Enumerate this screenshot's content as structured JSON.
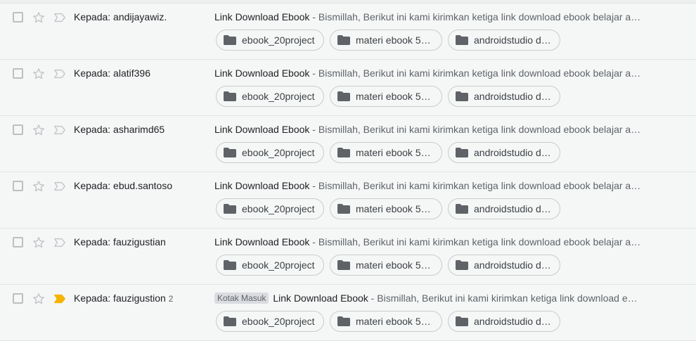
{
  "emails": [
    {
      "sender": "Kepada: andijayawiz.",
      "count": "",
      "label": "",
      "important": false,
      "subject": "Link Download Ebook",
      "separator": " - ",
      "preview": "Bismillah, Berikut ini kami kirimkan ketiga link download ebook belajar a…",
      "attachments": [
        "ebook_20project",
        "materi ebook 5 …",
        "androidstudio d…"
      ]
    },
    {
      "sender": "Kepada: alatif396",
      "count": "",
      "label": "",
      "important": false,
      "subject": "Link Download Ebook",
      "separator": " - ",
      "preview": "Bismillah, Berikut ini kami kirimkan ketiga link download ebook belajar a…",
      "attachments": [
        "ebook_20project",
        "materi ebook 5 …",
        "androidstudio d…"
      ]
    },
    {
      "sender": "Kepada: asharimd65",
      "count": "",
      "label": "",
      "important": false,
      "subject": "Link Download Ebook",
      "separator": " - ",
      "preview": "Bismillah, Berikut ini kami kirimkan ketiga link download ebook belajar a…",
      "attachments": [
        "ebook_20project",
        "materi ebook 5 …",
        "androidstudio d…"
      ]
    },
    {
      "sender": "Kepada: ebud.santoso",
      "count": "",
      "label": "",
      "important": false,
      "subject": "Link Download Ebook",
      "separator": " - ",
      "preview": "Bismillah, Berikut ini kami kirimkan ketiga link download ebook belajar a…",
      "attachments": [
        "ebook_20project",
        "materi ebook 5 …",
        "androidstudio d…"
      ]
    },
    {
      "sender": "Kepada: fauzigustian",
      "count": "",
      "label": "",
      "important": false,
      "subject": "Link Download Ebook",
      "separator": " - ",
      "preview": "Bismillah, Berikut ini kami kirimkan ketiga link download ebook belajar a…",
      "attachments": [
        "ebook_20project",
        "materi ebook 5 …",
        "androidstudio d…"
      ]
    },
    {
      "sender": "Kepada: fauzigustion",
      "count": "2",
      "label": "Kotak Masuk",
      "important": true,
      "subject": "Link Download Ebook",
      "separator": " - ",
      "preview": "Bismillah, Berikut ini kami kirimkan ketiga link download e…",
      "attachments": [
        "ebook_20project",
        "materi ebook 5 …",
        "androidstudio d…"
      ]
    }
  ],
  "colors": {
    "important_marker": "#f4b400",
    "icon_gray": "#c4c7c9",
    "folder_gray": "#5f6368"
  },
  "icons": {
    "checkbox": "checkbox-icon",
    "star": "star-icon",
    "importance": "importance-marker-icon",
    "folder": "folder-icon"
  }
}
